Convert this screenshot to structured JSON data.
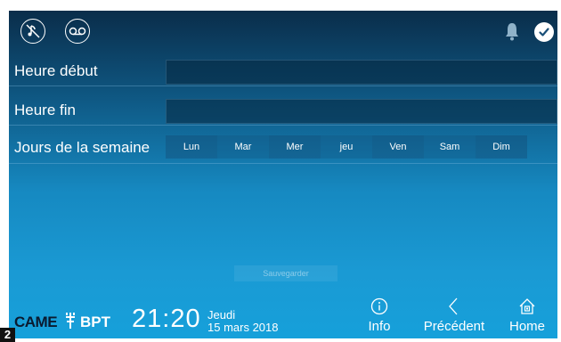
{
  "topbar": {
    "left_icons": [
      "music-mute-icon",
      "voicemail-icon"
    ],
    "right_icons": [
      "bell-icon",
      "check-icon"
    ]
  },
  "form": {
    "start_label": "Heure début",
    "start_value": "",
    "end_label": "Heure fin",
    "end_value": "",
    "days_label": "Jours de la semaine",
    "days": [
      "Lun",
      "Mar",
      "Mer",
      "jeu",
      "Ven",
      "Sam",
      "Dim"
    ]
  },
  "save": {
    "label": "Sauvegarder"
  },
  "footer": {
    "brand": "CAME",
    "brand2": "BPT",
    "time": "21:20",
    "day": "Jeudi",
    "date": "15 mars 2018",
    "nav": {
      "info": "Info",
      "previous": "Précédent",
      "home": "Home"
    }
  },
  "page_number": "2",
  "colors": {
    "screen_top": "#0a2d4a",
    "screen_bottom": "#16a0da",
    "text": "#ffffff",
    "brand_dark": "#0a1a30"
  }
}
